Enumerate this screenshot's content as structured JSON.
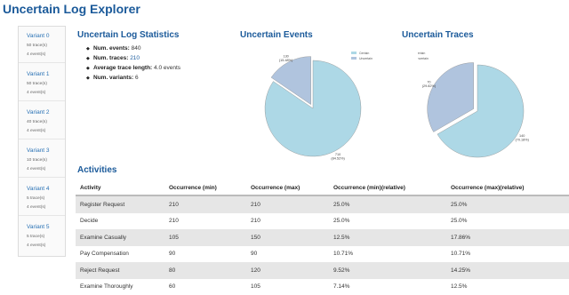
{
  "app": {
    "title": "Uncertain Log Explorer"
  },
  "sidebar": {
    "variants": [
      {
        "name": "Variant 0",
        "traces": "50 trace(s)",
        "events": "4 event(s)"
      },
      {
        "name": "Variant 1",
        "traces": "50 trace(s)",
        "events": "4 event(s)"
      },
      {
        "name": "Variant 2",
        "traces": "40 trace(s)",
        "events": "4 event(s)"
      },
      {
        "name": "Variant 3",
        "traces": "10 trace(s)",
        "events": "4 event(s)"
      },
      {
        "name": "Variant 4",
        "traces": "5 trace(s)",
        "events": "4 event(s)"
      },
      {
        "name": "Variant 5",
        "traces": "5 trace(s)",
        "events": "4 event(s)"
      }
    ]
  },
  "statistics": {
    "title": "Uncertain Log Statistics",
    "items": [
      {
        "label": "Num. events:",
        "value": "840"
      },
      {
        "label": "Num. traces:",
        "value": "210"
      },
      {
        "label": "Average trace length:",
        "value": "4.0 events"
      },
      {
        "label": "Num. variants:",
        "value": "6"
      }
    ]
  },
  "events_chart": {
    "title": "Uncertain Events"
  },
  "traces_chart": {
    "title": "Uncertain Traces"
  },
  "chart_data": [
    {
      "type": "pie",
      "title": "Uncertain Events",
      "categories": [
        "Certain",
        "Uncertain"
      ],
      "values": [
        710,
        130
      ],
      "slice_labels": [
        "710\n(84.52%)",
        "130\n(15.48%)"
      ],
      "colors": [
        "#add8e6",
        "#b0c4de"
      ],
      "legend": "top-right"
    },
    {
      "type": "pie",
      "title": "Uncertain Traces",
      "categories": [
        "Certain",
        "Uncertain"
      ],
      "values": [
        140,
        70
      ],
      "slice_labels": [
        "140\n(70.18%)",
        "70\n(29.82%)"
      ],
      "colors": [
        "#add8e6",
        "#b0c4de"
      ],
      "legend": "top-left"
    }
  ],
  "activities": {
    "title": "Activities",
    "columns": [
      "Activity",
      "Occurrence (min)",
      "Occurrence (max)",
      "Occurrence (min)(relative)",
      "Occurrence (max)(relative)"
    ],
    "rows": [
      [
        "Register Request",
        "210",
        "210",
        "25.0%",
        "25.0%"
      ],
      [
        "Decide",
        "210",
        "210",
        "25.0%",
        "25.0%"
      ],
      [
        "Examine Casually",
        "105",
        "150",
        "12.5%",
        "17.86%"
      ],
      [
        "Pay Compensation",
        "90",
        "90",
        "10.71%",
        "10.71%"
      ],
      [
        "Reject Request",
        "80",
        "120",
        "9.52%",
        "14.25%"
      ],
      [
        "Examine Thoroughly",
        "60",
        "105",
        "7.14%",
        "12.5%"
      ]
    ]
  }
}
